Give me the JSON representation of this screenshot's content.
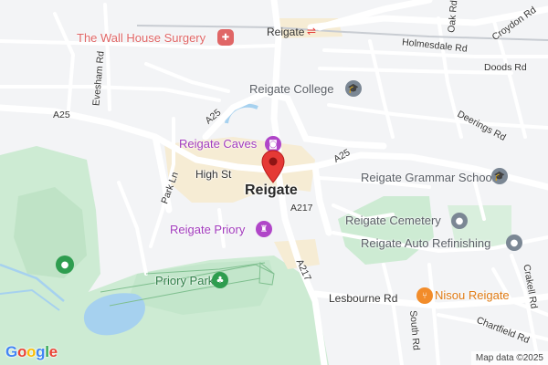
{
  "map": {
    "town_label": "Reigate",
    "station_label": "Reigate",
    "attribution": "Map data ©2025",
    "logo_text": "Google",
    "logo_colors": [
      "#4285f4",
      "#ea4335",
      "#fbbc05",
      "#4285f4",
      "#34a853",
      "#ea4335"
    ],
    "marker_color": "#e53935"
  },
  "roads": {
    "a25_west": "A25",
    "a25_mid": "A25",
    "a25_east": "A25",
    "a217_north": "A217",
    "a217_south": "A217",
    "high_st": "High St",
    "park_ln": "Park Ln",
    "evesham_rd": "Evesham Rd",
    "holmesdale_rd": "Holmesdale Rd",
    "doods_rd": "Doods Rd",
    "oak_rd": "Oak Rd",
    "croydon_rd": "Croydon Rd",
    "deerings_rd": "Deerings Rd",
    "lesbourne_rd": "Lesbourne Rd",
    "south_rd": "South Rd",
    "crakell_rd": "Crakell Rd",
    "chartfield_rd": "Chartfield Rd"
  },
  "pois": {
    "wall_house": {
      "label": "The Wall House Surgery",
      "icon": "medical-cross-icon",
      "color": "#e06666"
    },
    "college": {
      "label": "Reigate College",
      "icon": "graduation-cap-icon",
      "color": "#7b8794"
    },
    "caves": {
      "label": "Reigate Caves",
      "icon": "camera-icon",
      "color": "#b046c8"
    },
    "grammar": {
      "label": "Reigate Grammar School",
      "icon": "graduation-cap-icon",
      "color": "#7b8794"
    },
    "priory": {
      "label": "Reigate Priory",
      "icon": "castle-icon",
      "color": "#b046c8"
    },
    "cemetery": {
      "label": "Reigate Cemetery",
      "icon": "cemetery-icon",
      "color": "#7b8794"
    },
    "auto": {
      "label": "Reigate Auto Refinishing",
      "icon": "pin-dot-icon",
      "color": "#7b8794"
    },
    "priory_park": {
      "label": "Priory Park",
      "icon": "tree-icon",
      "color": "#2e9d4f"
    },
    "nisou": {
      "label": "Nisou Reigate",
      "icon": "fork-knife-icon",
      "color": "#f28c2a"
    },
    "park_pin": {
      "icon": "park-pin-icon",
      "color": "#2e9d4f"
    }
  }
}
